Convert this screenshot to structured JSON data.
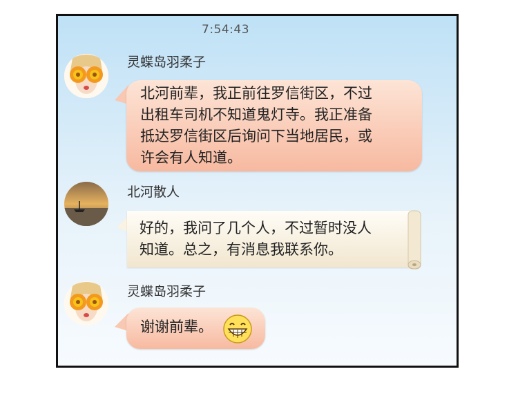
{
  "chat": {
    "timestamp": "7:54:43",
    "messages": [
      {
        "sender": "灵蝶岛羽柔子",
        "lines": [
          "北河前辈，我正前往罗信街区，不过",
          "出租车司机不知道鬼灯寺。我正准备",
          "抵达罗信街区后询问下当地居民，或",
          "许会有人知道。"
        ],
        "style": "pink-bubble"
      },
      {
        "sender": "北河散人",
        "lines": [
          "好的，我问了几个人，不过暂时没人",
          "知道。总之，有消息我联系你。"
        ],
        "style": "scroll-bubble"
      },
      {
        "sender": "灵蝶岛羽柔子",
        "lines": [
          "谢谢前辈。"
        ],
        "style": "pink-bubble",
        "emoji": "grinning-face-emoji"
      }
    ]
  },
  "colors": {
    "pink_bubble": "#f7b9a0",
    "scroll_bubble": "#f1e6cf",
    "background": "#bfe1f6"
  }
}
